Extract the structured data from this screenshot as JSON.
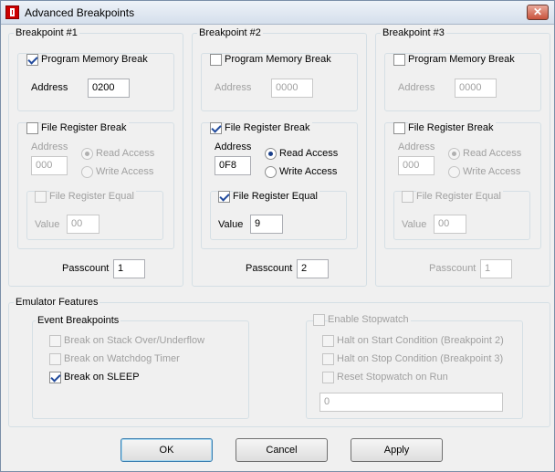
{
  "window": {
    "title": "Advanced Breakpoints",
    "close_label": "✕"
  },
  "bp1": {
    "title": "Breakpoint #1",
    "pm_label": "Program Memory Break",
    "pm_checked": true,
    "address_label": "Address",
    "address_value": "0200",
    "fr_label": "File Register Break",
    "fr_checked": false,
    "fr_address_label": "Address",
    "fr_address_value": "000",
    "read_label": "Read Access",
    "write_label": "Write Access",
    "fre_label": "File Register Equal",
    "fre_checked": false,
    "value_label": "Value",
    "value_value": "00",
    "passcount_label": "Passcount",
    "passcount_value": "1"
  },
  "bp2": {
    "title": "Breakpoint #2",
    "pm_label": "Program Memory Break",
    "pm_checked": false,
    "address_label": "Address",
    "address_value": "0000",
    "fr_label": "File Register Break",
    "fr_checked": true,
    "fr_address_label": "Address",
    "fr_address_value": "0F8",
    "read_label": "Read Access",
    "write_label": "Write Access",
    "fre_label": "File Register Equal",
    "fre_checked": true,
    "value_label": "Value",
    "value_value": "9",
    "passcount_label": "Passcount",
    "passcount_value": "2"
  },
  "bp3": {
    "title": "Breakpoint #3",
    "pm_label": "Program Memory Break",
    "pm_checked": false,
    "address_label": "Address",
    "address_value": "0000",
    "fr_label": "File Register Break",
    "fr_checked": false,
    "fr_address_label": "Address",
    "fr_address_value": "000",
    "read_label": "Read Access",
    "write_label": "Write Access",
    "fre_label": "File Register Equal",
    "fre_checked": false,
    "value_label": "Value",
    "value_value": "00",
    "passcount_label": "Passcount",
    "passcount_value": "1"
  },
  "emulator": {
    "title": "Emulator Features",
    "event_title": "Event Breakpoints",
    "stack_label": "Break on Stack Over/Underflow",
    "watchdog_label": "Break on Watchdog Timer",
    "sleep_label": "Break on SLEEP",
    "stopwatch_label": "Enable Stopwatch",
    "halt_start_label": "Halt on Start Condition (Breakpoint 2)",
    "halt_stop_label": "Halt on Stop Condition (Breakpoint 3)",
    "reset_label": "Reset Stopwatch on Run",
    "stopwatch_value": "0"
  },
  "buttons": {
    "ok": "OK",
    "cancel": "Cancel",
    "apply": "Apply"
  }
}
